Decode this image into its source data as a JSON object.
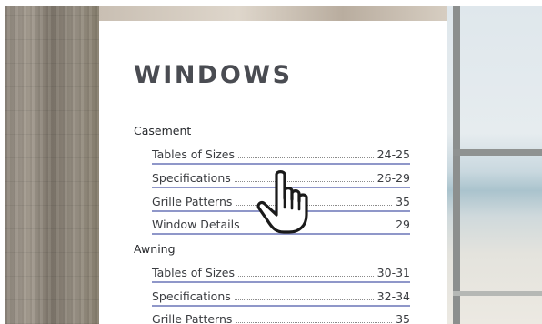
{
  "catalog": {
    "title": "WINDOWS",
    "sections": [
      {
        "name": "Casement",
        "entries": [
          {
            "label": "Tables of Sizes",
            "pages": "24-25"
          },
          {
            "label": "Specifications",
            "pages": "26-29"
          },
          {
            "label": "Grille Patterns",
            "pages": "35"
          },
          {
            "label": "Window Details",
            "pages": "29"
          }
        ]
      },
      {
        "name": "Awning",
        "entries": [
          {
            "label": "Tables of Sizes",
            "pages": "30-31"
          },
          {
            "label": "Specifications",
            "pages": "32-34"
          },
          {
            "label": "Grille Patterns",
            "pages": "35"
          }
        ]
      }
    ]
  },
  "cursor": {
    "icon": "hand-pointer-icon"
  },
  "colors": {
    "link_underline": "#8f97c9",
    "title": "#4a4c52",
    "text": "#3a3c40"
  }
}
